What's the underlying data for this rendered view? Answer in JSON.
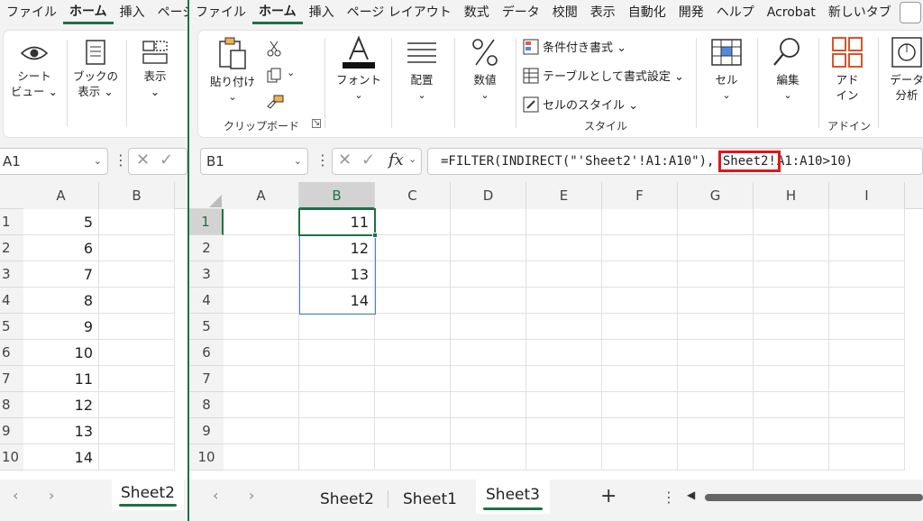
{
  "left_window": {
    "menu": [
      "ファイル",
      "ホーム",
      "挿入",
      "ページ"
    ],
    "ribbon": {
      "sheet_view": "シート\nビュー ⌄",
      "workbook_view": "ブックの\n表示 ⌄",
      "show": "表示\n⌄"
    },
    "namebox": "A1",
    "columns": [
      "A",
      "B"
    ],
    "rows": [
      "1",
      "2",
      "3",
      "4",
      "5",
      "6",
      "7",
      "8",
      "9",
      "10"
    ],
    "colA": [
      "5",
      "6",
      "7",
      "8",
      "9",
      "10",
      "11",
      "12",
      "13",
      "14"
    ],
    "sheet_tab": "Sheet2"
  },
  "right_window": {
    "menu": [
      "ファイル",
      "ホーム",
      "挿入",
      "ページ レイアウト",
      "数式",
      "データ",
      "校閲",
      "表示",
      "自動化",
      "開発",
      "ヘルプ",
      "Acrobat",
      "新しいタブ"
    ],
    "active_menu_index": 1,
    "ribbon": {
      "paste": "貼り付け",
      "clipboard_group": "クリップボード",
      "font": "フォント",
      "alignment": "配置",
      "number": "数値",
      "conditional_format": "条件付き書式 ⌄",
      "format_as_table": "テーブルとして書式設定 ⌄",
      "cell_styles": "セルのスタイル ⌄",
      "styles_group": "スタイル",
      "cells": "セル",
      "editing": "編集",
      "addins": "アド\nイン",
      "addins_group": "アドイン",
      "data_analysis": "データ\n分析"
    },
    "namebox": "B1",
    "formula_prefix": "=FILTER(INDIRECT(\"'Sheet2'!A1:A10\"), ",
    "formula_highlight": "Sheet2!",
    "formula_suffix": "A1:A10>10)",
    "columns": [
      "A",
      "B",
      "C",
      "D",
      "E",
      "F",
      "G",
      "H",
      "I"
    ],
    "rows": [
      "1",
      "2",
      "3",
      "4",
      "5",
      "6",
      "7",
      "8",
      "9",
      "10"
    ],
    "colB": [
      "11",
      "12",
      "13",
      "14"
    ],
    "sheet_tabs": [
      "Sheet2",
      "Sheet1",
      "Sheet3"
    ],
    "active_tab_index": 2,
    "add_sheet": "+",
    "more": "⋮",
    "fx_label": "fx"
  },
  "colors": {
    "excel_green": "#1e7145",
    "highlight_box": "#e0161b",
    "selection": "#1e7145"
  }
}
